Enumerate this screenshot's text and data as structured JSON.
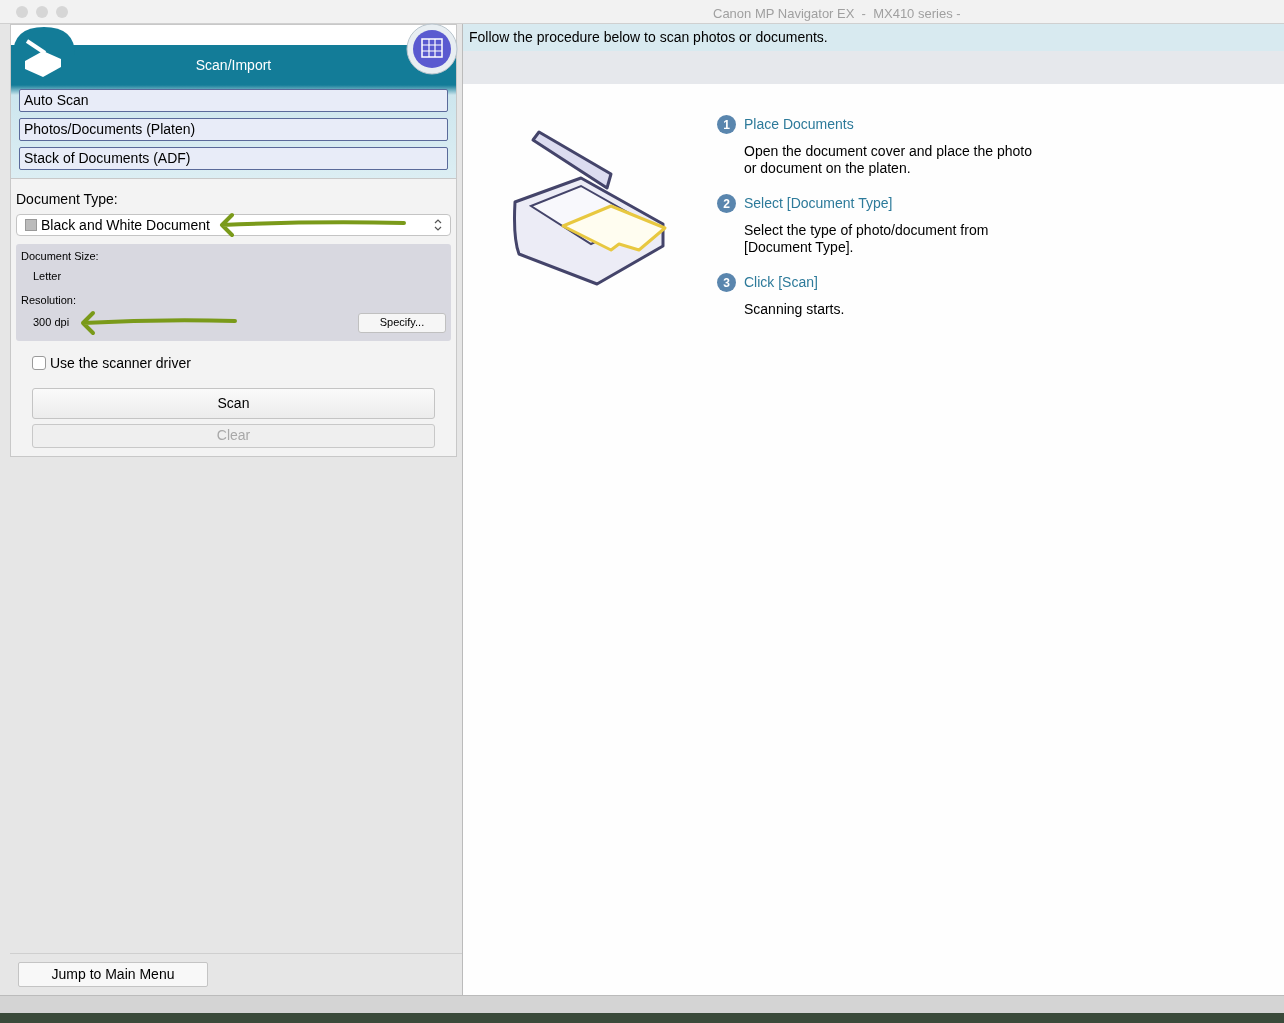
{
  "window": {
    "title": "Canon MP Navigator EX  -  MX410 series -"
  },
  "sidebar": {
    "title": "Scan/Import",
    "modes": [
      {
        "label": "Auto Scan"
      },
      {
        "label": "Photos/Documents (Platen)"
      },
      {
        "label": "Stack of Documents (ADF)"
      }
    ],
    "document_type": {
      "label": "Document Type:",
      "value": "Black and White Document"
    },
    "settings": {
      "size_label": "Document Size:",
      "size": "Letter",
      "resolution_label": "Resolution:",
      "resolution": "300 dpi",
      "specify_button": "Specify..."
    },
    "scanner_driver": {
      "label": "Use the scanner driver",
      "checked": false
    },
    "scan_button": "Scan",
    "clear_button": {
      "label": "Clear",
      "disabled": true
    },
    "main_menu_button": "Jump to Main Menu"
  },
  "instructions": "Follow the procedure below to scan photos or documents.",
  "steps": [
    {
      "number": "1",
      "title": "Place Documents",
      "text": "Open the document cover and place the photo or document on the platen."
    },
    {
      "number": "2",
      "title": "Select [Document Type]",
      "text": "Select the type of photo/document from [Document Type]."
    },
    {
      "number": "3",
      "title": "Click [Scan]",
      "text": "Scanning starts."
    }
  ]
}
